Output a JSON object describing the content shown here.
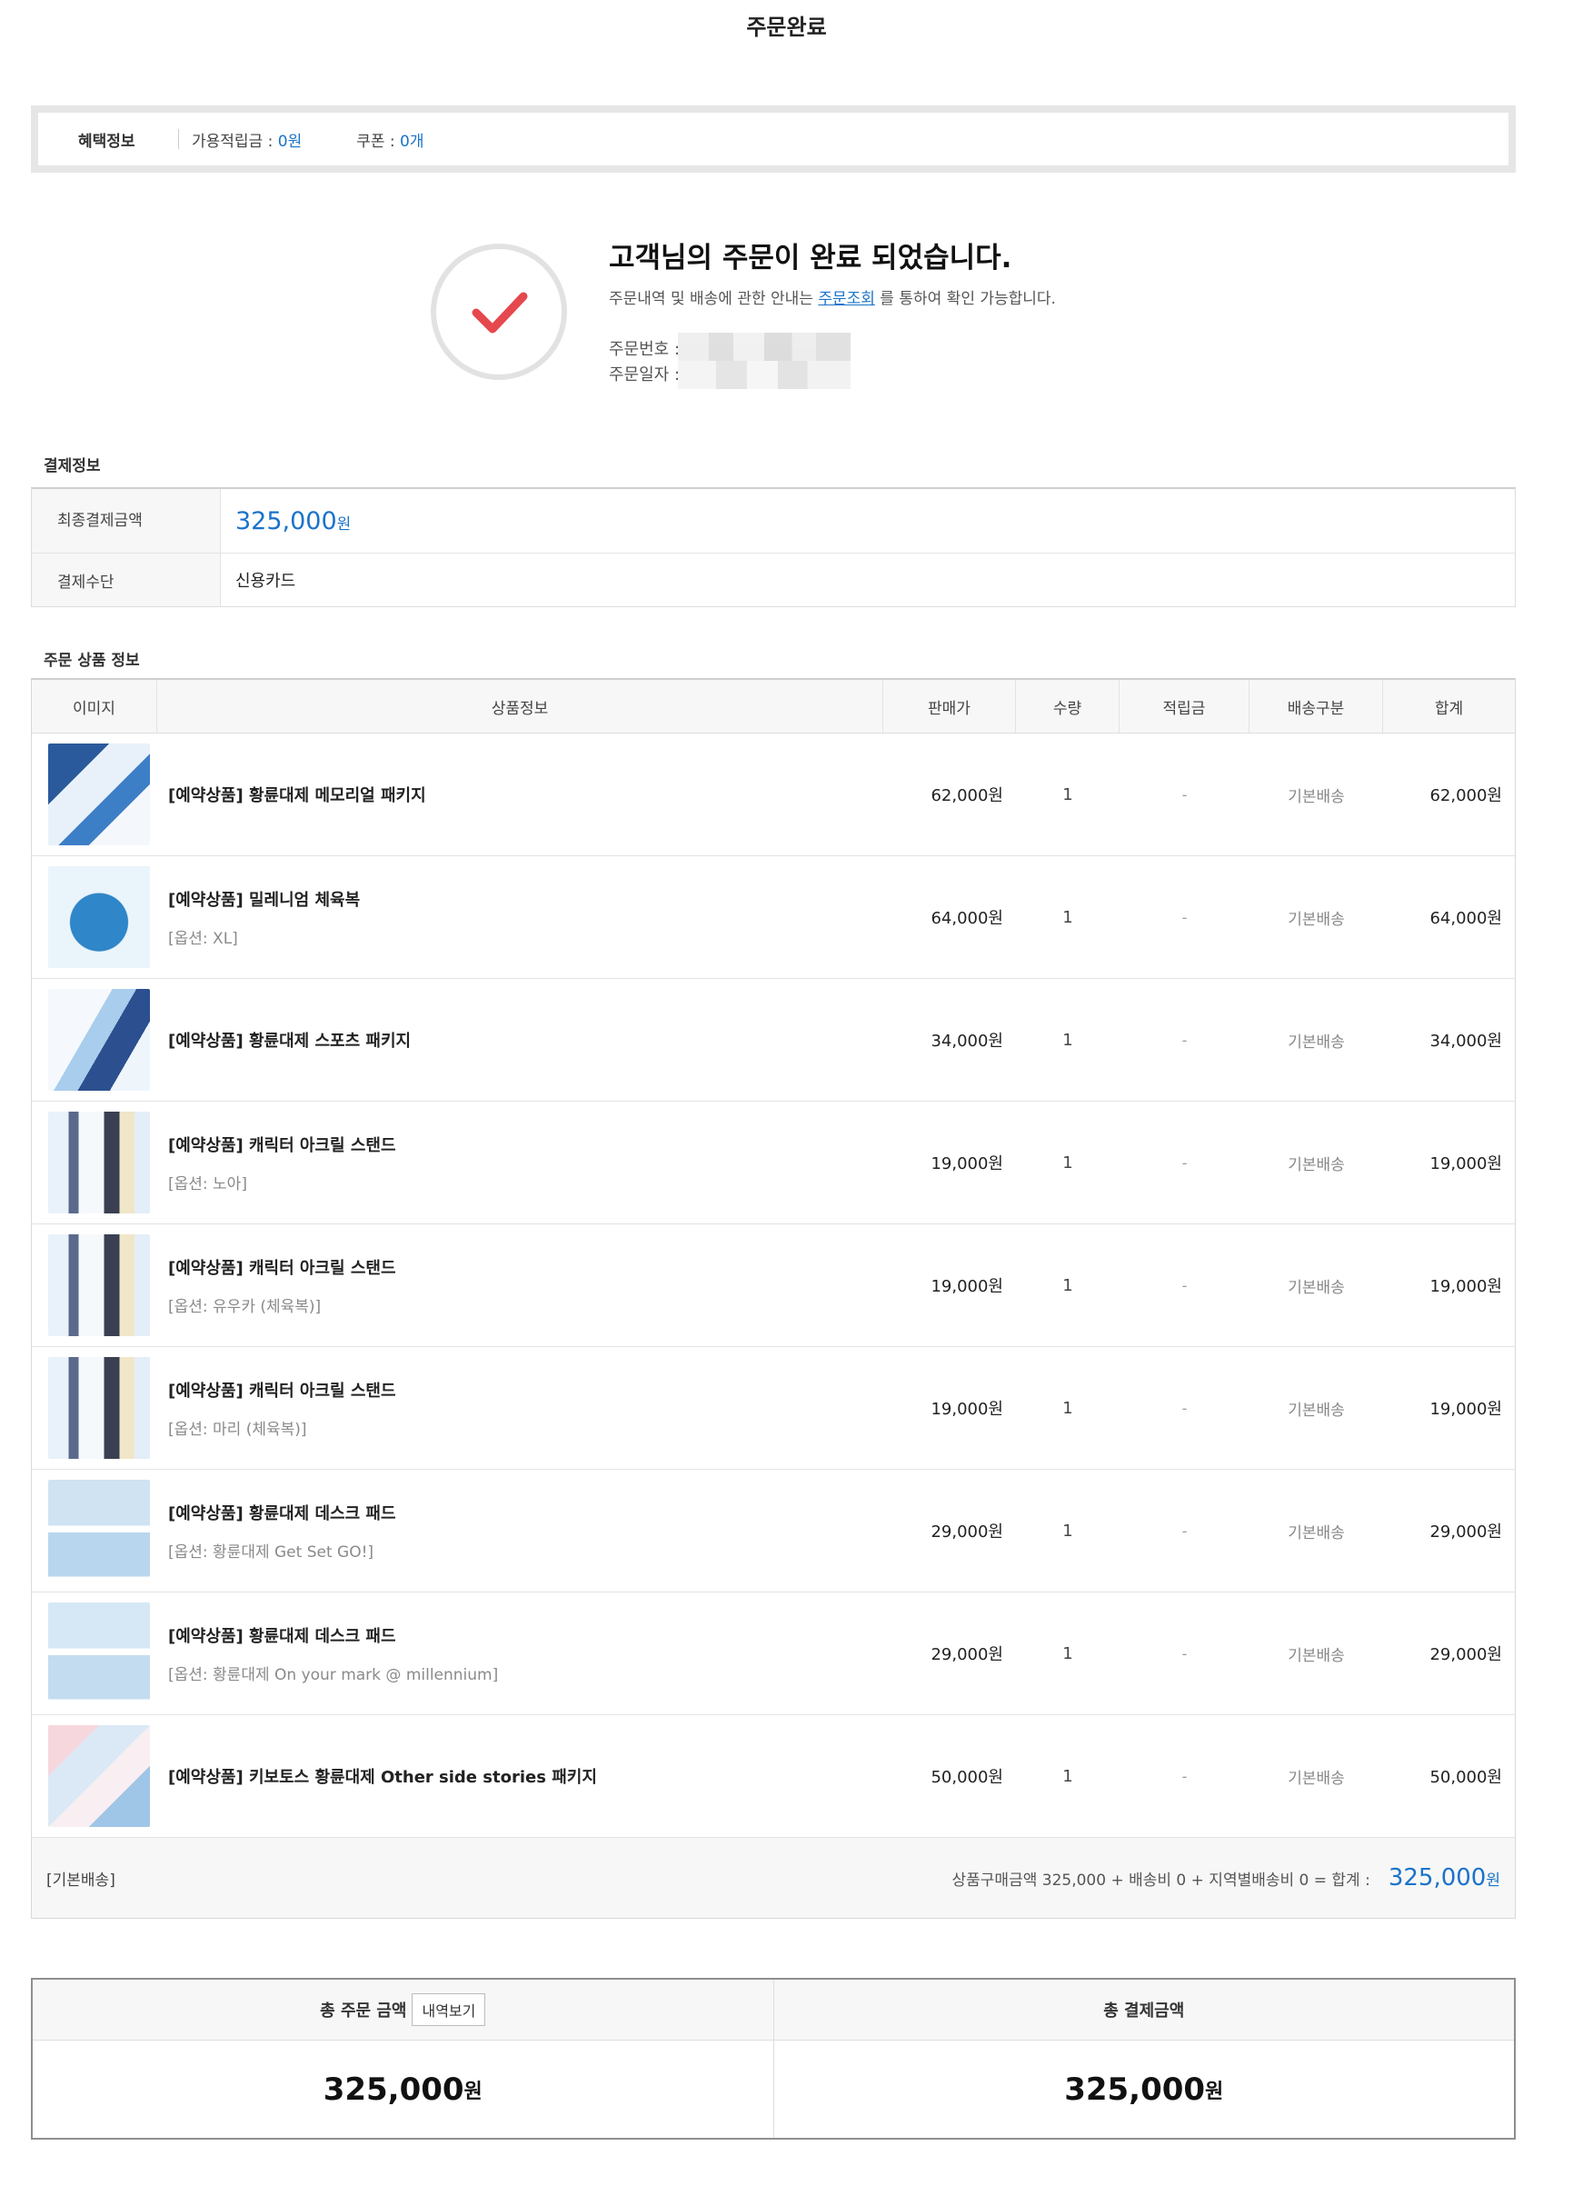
{
  "page": {
    "title": "주문완료"
  },
  "benefit": {
    "title": "혜택정보",
    "points_label": "가용적립금 : ",
    "points_value": "0원",
    "coupon_label": "쿠폰 : ",
    "coupon_value": "0개"
  },
  "complete": {
    "title": "고객님의 주문이 완료 되었습니다.",
    "desc_before": "주문내역 및 배송에 관한 안내는 ",
    "desc_link": "주문조회",
    "desc_after": " 를 통하여 확인 가능합니다.",
    "order_no_label": "주문번호 :",
    "order_date_label": "주문일자 :"
  },
  "payment": {
    "section_label": "결제정보",
    "final_label": "최종결제금액",
    "final_amount": "325,000",
    "won": "원",
    "method_label": "결제수단",
    "method_value": "신용카드"
  },
  "products": {
    "section_label": "주문 상품 정보",
    "headers": [
      "이미지",
      "상품정보",
      "판매가",
      "수량",
      "적립금",
      "배송구분",
      "합계"
    ],
    "rows": [
      {
        "name": "[예약상품] 황륜대제 메모리얼 패키지",
        "option": "",
        "price": "62,000원",
        "qty": "1",
        "point": "-",
        "ship": "기본배송",
        "total": "62,000원"
      },
      {
        "name": "[예약상품] 밀레니엄 체육복",
        "option": "[옵션: XL]",
        "price": "64,000원",
        "qty": "1",
        "point": "-",
        "ship": "기본배송",
        "total": "64,000원"
      },
      {
        "name": "[예약상품] 황륜대제 스포츠 패키지",
        "option": "",
        "price": "34,000원",
        "qty": "1",
        "point": "-",
        "ship": "기본배송",
        "total": "34,000원"
      },
      {
        "name": "[예약상품] 캐릭터 아크릴 스탠드",
        "option": "[옵션: 노아]",
        "price": "19,000원",
        "qty": "1",
        "point": "-",
        "ship": "기본배송",
        "total": "19,000원"
      },
      {
        "name": "[예약상품] 캐릭터 아크릴 스탠드",
        "option": "[옵션: 유우카 (체육복)]",
        "price": "19,000원",
        "qty": "1",
        "point": "-",
        "ship": "기본배송",
        "total": "19,000원"
      },
      {
        "name": "[예약상품] 캐릭터 아크릴 스탠드",
        "option": "[옵션: 마리 (체육복)]",
        "price": "19,000원",
        "qty": "1",
        "point": "-",
        "ship": "기본배송",
        "total": "19,000원"
      },
      {
        "name": "[예약상품] 황륜대제 데스크 패드",
        "option": "[옵션: 황륜대제 Get Set GO!]",
        "price": "29,000원",
        "qty": "1",
        "point": "-",
        "ship": "기본배송",
        "total": "29,000원"
      },
      {
        "name": "[예약상품] 황륜대제 데스크 패드",
        "option": "[옵션: 황륜대제 On your mark @ millennium]",
        "price": "29,000원",
        "qty": "1",
        "point": "-",
        "ship": "기본배송",
        "total": "29,000원"
      },
      {
        "name": "[예약상품] 키보토스 황륜대제 Other side stories 패키지",
        "option": "",
        "price": "50,000원",
        "qty": "1",
        "point": "-",
        "ship": "기본배송",
        "total": "50,000원"
      }
    ],
    "footer_left": "[기본배송]",
    "footer_formula": "상품구매금액 325,000 + 배송비 0 + 지역별배송비 0 = 합계 :",
    "footer_sum": "325,000",
    "footer_won": "원"
  },
  "totals": {
    "order_label": "총 주문 금액",
    "detail_button": "내역보기",
    "order_amount": "325,000",
    "pay_label": "총 결제금액",
    "pay_amount": "325,000",
    "won": "원"
  },
  "colors": {
    "accent_blue": "#1a73c9",
    "check_red": "#e5484d"
  }
}
